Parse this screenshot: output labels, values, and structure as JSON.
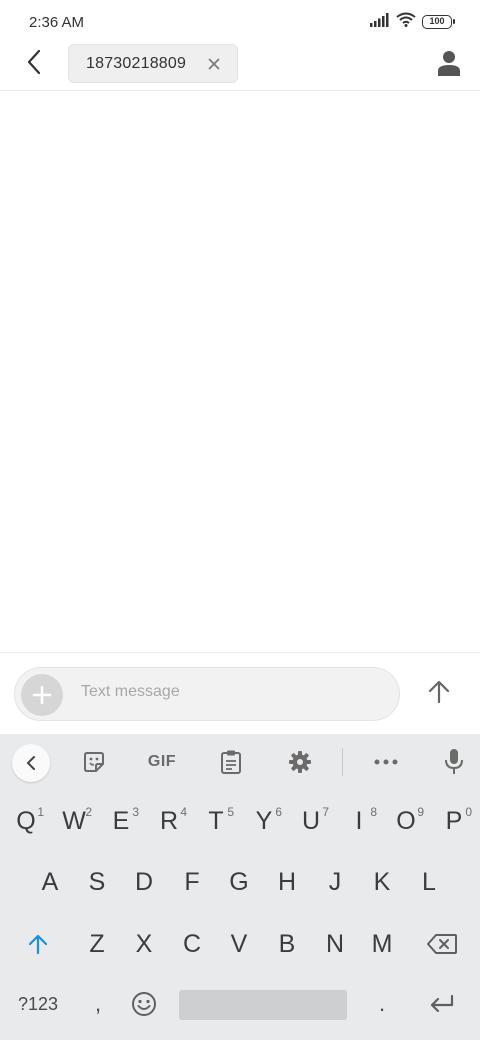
{
  "status_bar": {
    "time": "2:36 AM",
    "battery_level": "100",
    "icons": [
      "signal-icon",
      "wifi-icon",
      "battery-icon"
    ]
  },
  "header": {
    "back_icon": "back-arrow-icon",
    "recipient": "18730218809",
    "remove_recipient_icon": "close-icon",
    "contact_icon": "person-icon"
  },
  "compose": {
    "attach_icon": "plus-icon",
    "placeholder": "Text message",
    "send_icon": "arrow-up-icon"
  },
  "keyboard": {
    "toolbar": {
      "collapse_icon": "chevron-left-icon",
      "sticker_icon": "sticker-icon",
      "gif_label": "GIF",
      "clipboard_icon": "clipboard-icon",
      "settings_icon": "gear-icon",
      "more_icon": "more-horizontal-icon",
      "mic_icon": "microphone-icon"
    },
    "row1": [
      {
        "label": "Q",
        "hint": "1"
      },
      {
        "label": "W",
        "hint": "2"
      },
      {
        "label": "E",
        "hint": "3"
      },
      {
        "label": "R",
        "hint": "4"
      },
      {
        "label": "T",
        "hint": "5"
      },
      {
        "label": "Y",
        "hint": "6"
      },
      {
        "label": "U",
        "hint": "7"
      },
      {
        "label": "I",
        "hint": "8"
      },
      {
        "label": "O",
        "hint": "9"
      },
      {
        "label": "P",
        "hint": "0"
      }
    ],
    "row2": [
      "A",
      "S",
      "D",
      "F",
      "G",
      "H",
      "J",
      "K",
      "L"
    ],
    "row3": [
      "Z",
      "X",
      "C",
      "V",
      "B",
      "N",
      "M"
    ],
    "shift_icon": "shift-arrow-icon",
    "backspace_icon": "backspace-icon",
    "symbols_label": "?123",
    "comma_label": ",",
    "emoji_icon": "emoji-icon",
    "period_label": ".",
    "enter_icon": "enter-icon"
  },
  "colors": {
    "accent": "#1a8fe0",
    "keyboard_bg": "#e8eaeb",
    "field_bg": "#f2f2f2"
  }
}
